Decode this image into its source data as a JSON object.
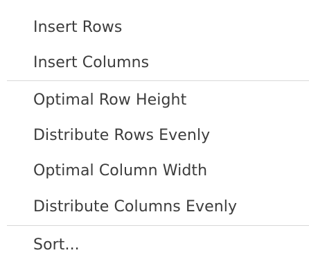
{
  "context_menu": {
    "items": [
      {
        "label": "Insert Rows"
      },
      {
        "label": "Insert Columns"
      },
      {
        "label": "Optimal Row Height"
      },
      {
        "label": "Distribute Rows Evenly"
      },
      {
        "label": "Optimal Column Width"
      },
      {
        "label": "Distribute Columns Evenly"
      },
      {
        "label": "Sort..."
      }
    ]
  }
}
